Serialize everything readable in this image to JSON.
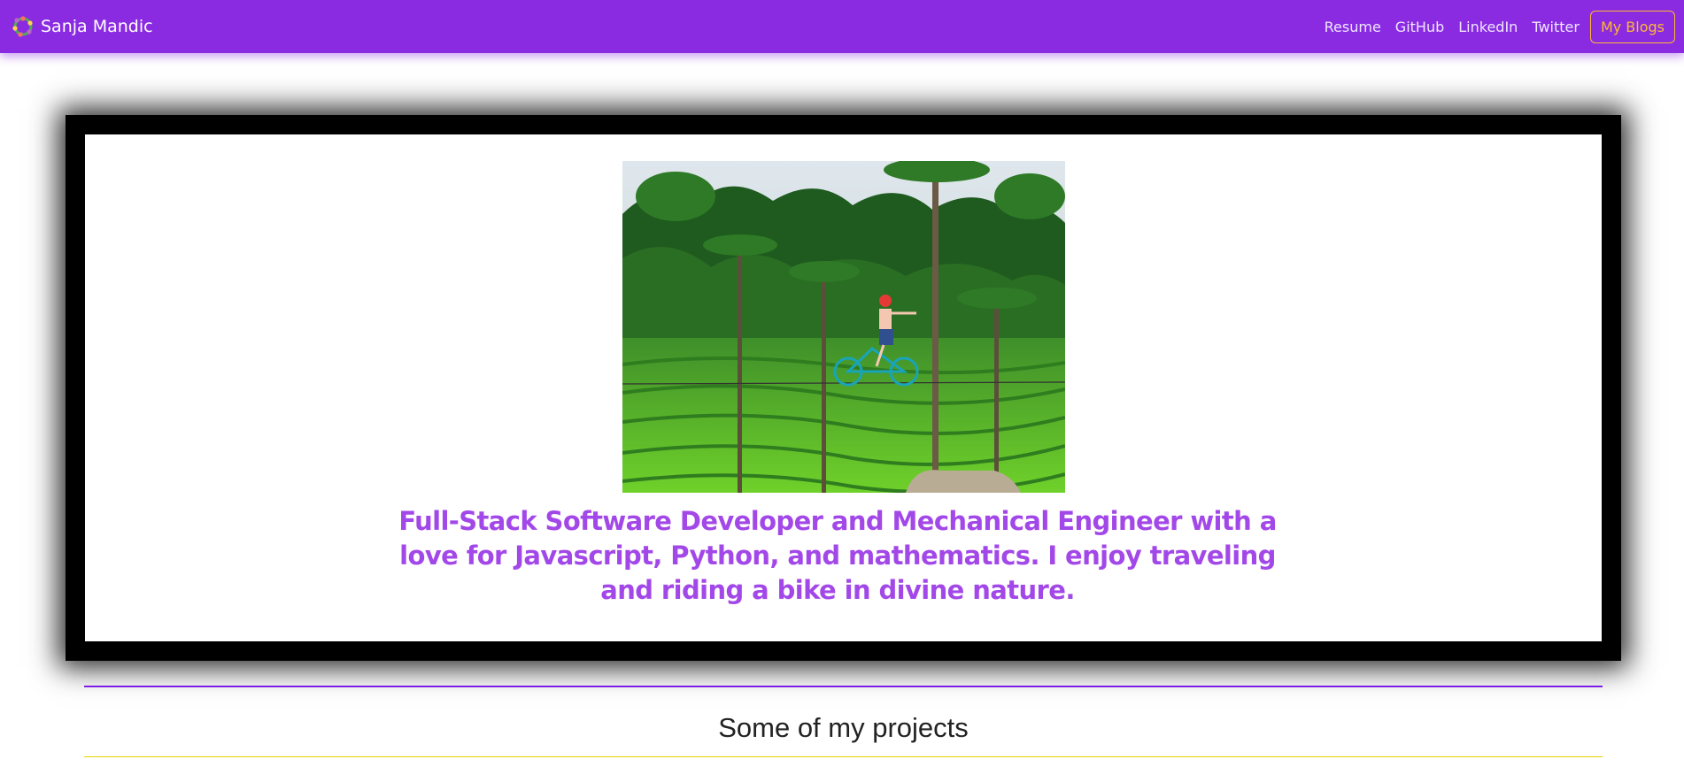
{
  "brand": {
    "name": "Sanja Mandic",
    "logo_icon": "flower-wreath-icon"
  },
  "nav": {
    "links": [
      "Resume",
      "GitHub",
      "LinkedIn",
      "Twitter"
    ],
    "blogs_label": "My Blogs"
  },
  "hero": {
    "photo_icon": "rice-terrace-bike-photo",
    "text": "Full-Stack Software Developer and Mechanical Engineer with a love for Javascript, Python, and mathematics. I enjoy traveling and riding a bike in divine nature."
  },
  "projects": {
    "title": "Some of my projects"
  },
  "colors": {
    "navbar": "#8a2be2",
    "accent_text": "#a348e8",
    "blogs_button": "#ffb732",
    "divider_top": "#7f1fe6",
    "divider_bottom": "#e6d200"
  }
}
